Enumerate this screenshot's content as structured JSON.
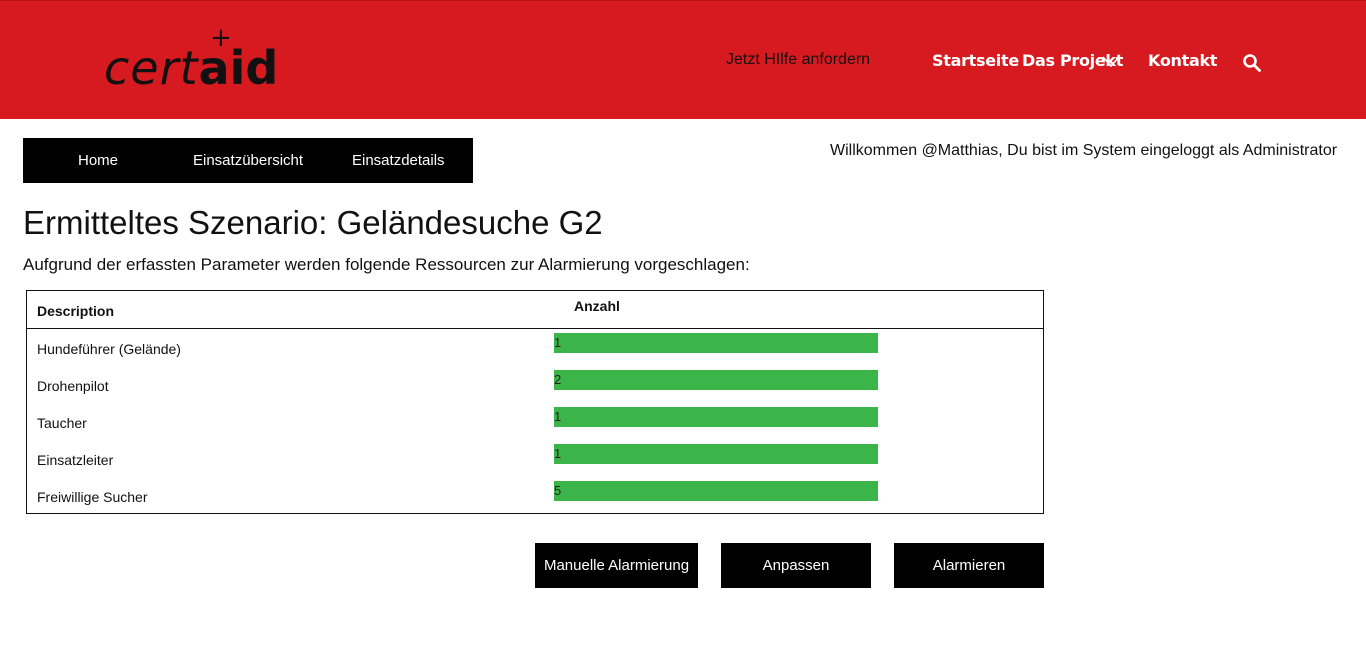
{
  "header": {
    "logo_left": "cert",
    "logo_right": "aid",
    "logo_plus": "+",
    "help_link": "Jetzt HIlfe anfordern",
    "nav": {
      "home": "Startseite",
      "project": "Das Projekt",
      "contact": "Kontakt"
    },
    "icons": {
      "dropdown": "chevron-down-icon",
      "search": "search-icon"
    },
    "brand_color": "#d71920"
  },
  "subnav": {
    "items": [
      "Home",
      "Einsatzübersicht",
      "Einsatzdetails"
    ]
  },
  "welcome_text": "Willkommen @Matthias, Du bist im System eingeloggt als Administrator",
  "page_title": "Ermitteltes Szenario: Geländesuche G2",
  "intro_text": "Aufgrund der erfassten Parameter werden folgende Ressourcen zur Alarmierung vorgeschlagen:",
  "table": {
    "headers": {
      "description": "Description",
      "count": "Anzahl"
    },
    "bar_color": "#3bb54a",
    "rows": [
      {
        "description": "Hundeführer (Gelände)",
        "count": "1"
      },
      {
        "description": "Drohenpilot",
        "count": "2"
      },
      {
        "description": "Taucher",
        "count": "1"
      },
      {
        "description": "Einsatzleiter",
        "count": "1"
      },
      {
        "description": "Freiwillige Sucher",
        "count": "5"
      }
    ]
  },
  "buttons": {
    "manual": "Manuelle Alarmierung",
    "adjust": "Anpassen",
    "alarm": "Alarmieren"
  }
}
